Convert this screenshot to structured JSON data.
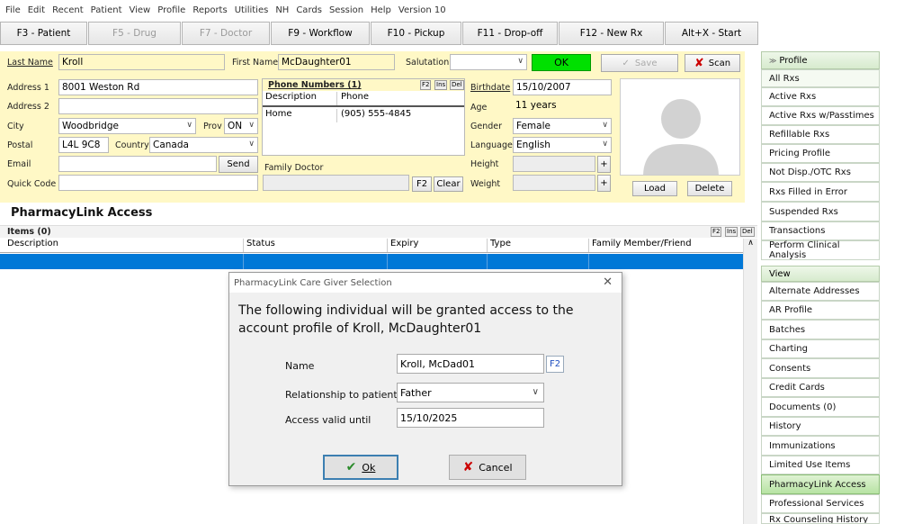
{
  "menu": [
    "File",
    "Edit",
    "Recent",
    "Patient",
    "View",
    "Profile",
    "Reports",
    "Utilities",
    "NH",
    "Cards",
    "Session",
    "Help",
    "Version 10"
  ],
  "fkeys": [
    {
      "label": "F3 - Patient",
      "disabled": false
    },
    {
      "label": "F5 - Drug",
      "disabled": true
    },
    {
      "label": "F7 - Doctor",
      "disabled": true
    },
    {
      "label": "F9 - Workflow",
      "disabled": false
    },
    {
      "label": "F10 - Pickup",
      "disabled": false
    },
    {
      "label": "F11 - Drop-off",
      "disabled": false
    },
    {
      "label": "F12 - New Rx",
      "disabled": false
    },
    {
      "label": "Alt+X - Start",
      "disabled": false
    }
  ],
  "patient": {
    "last_name_label": "Last Name",
    "last_name": "Kroll",
    "first_name_label": "First Name",
    "first_name": "McDaughter01",
    "salutation_label": "Salutation",
    "salutation": "",
    "ok_label": "OK",
    "save_label": "Save",
    "scan_label": "Scan",
    "address1_label": "Address 1",
    "address1": "8001 Weston Rd",
    "address2_label": "Address 2",
    "address2": "",
    "city_label": "City",
    "city": "Woodbridge",
    "prov_label": "Prov",
    "prov": "ON",
    "postal_label": "Postal",
    "postal": "L4L 9C8",
    "country_label": "Country",
    "country": "Canada",
    "email_label": "Email",
    "email": "",
    "send_label": "Send",
    "quick_code_label": "Quick Code",
    "quick_code": "",
    "birthdate_label": "Birthdate",
    "birthdate": "15/10/2007",
    "age_label": "Age",
    "age": "11 years",
    "gender_label": "Gender",
    "gender": "Female",
    "language_label": "Language",
    "language": "English",
    "height_label": "Height",
    "height": "",
    "weight_label": "Weight",
    "weight": "",
    "load_label": "Load",
    "delete_label": "Delete"
  },
  "phones": {
    "title": "Phone Numbers (1)",
    "f2": "F2",
    "ins": "Ins",
    "del": "Del",
    "col_desc": "Description",
    "col_phone": "Phone",
    "rows": [
      {
        "desc": "Home",
        "phone": "(905) 555-4845"
      }
    ]
  },
  "doctor": {
    "label": "Family Doctor",
    "value": "",
    "f2": "F2",
    "clear": "Clear"
  },
  "access": {
    "title": "PharmacyLink Access",
    "items_label": "Items (0)",
    "f2": "F2",
    "ins": "Ins",
    "del": "Del",
    "columns": [
      "Description",
      "Status",
      "Expiry",
      "Type",
      "Family Member/Friend"
    ]
  },
  "dialog": {
    "title": "PharmacyLink Care Giver Selection",
    "message": "The following individual will be granted access to the account profile of Kroll, McDaughter01",
    "name_label": "Name",
    "name": "Kroll, McDad01",
    "f2": "F2",
    "relationship_label": "Relationship to patient",
    "relationship": "Father",
    "valid_label": "Access valid until",
    "valid_until": "15/10/2025",
    "ok_label": "Ok",
    "cancel_label": "Cancel"
  },
  "sidebar": {
    "profile_title": "Profile",
    "profile_items": [
      "All Rxs",
      "Active Rxs",
      "Active Rxs w/Passtimes",
      "Refillable Rxs",
      "Pricing Profile",
      "Not Disp./OTC Rxs",
      "Rxs Filled in Error",
      "Suspended Rxs",
      "Transactions",
      "Perform Clinical Analysis"
    ],
    "view_title": "View",
    "view_items": [
      "Alternate Addresses",
      "AR Profile",
      "Batches",
      "Charting",
      "Consents",
      "Credit Cards",
      "Documents (0)",
      "History",
      "Immunizations",
      "Limited Use Items",
      "PharmacyLink Access",
      "Professional Services",
      "Rx Counseling History"
    ],
    "active_item": "PharmacyLink Access"
  },
  "colors": {
    "form_bg": "#fff8c6",
    "selected_row": "#0078d7",
    "ok_green": "#00e000",
    "sidebar_active": "#b7e3a3"
  }
}
